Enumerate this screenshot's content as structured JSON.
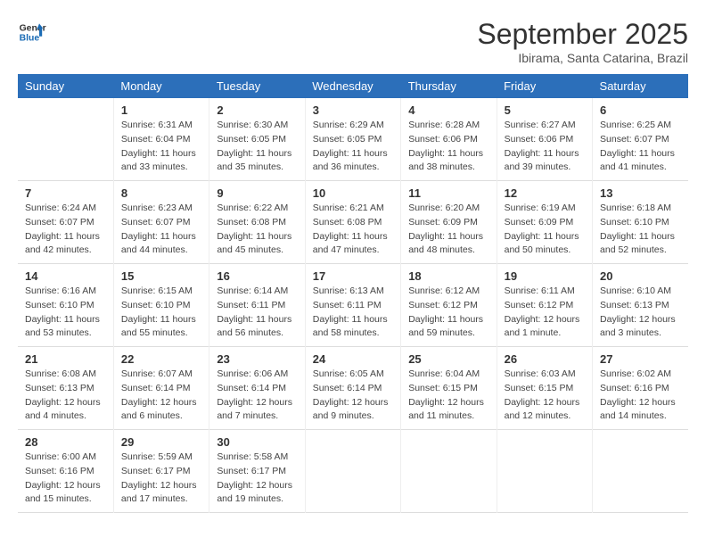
{
  "logo": {
    "line1": "General",
    "line2": "Blue"
  },
  "title": "September 2025",
  "location": "Ibirama, Santa Catarina, Brazil",
  "days_header": [
    "Sunday",
    "Monday",
    "Tuesday",
    "Wednesday",
    "Thursday",
    "Friday",
    "Saturday"
  ],
  "weeks": [
    [
      {
        "num": "",
        "info": ""
      },
      {
        "num": "1",
        "info": "Sunrise: 6:31 AM\nSunset: 6:04 PM\nDaylight: 11 hours\nand 33 minutes."
      },
      {
        "num": "2",
        "info": "Sunrise: 6:30 AM\nSunset: 6:05 PM\nDaylight: 11 hours\nand 35 minutes."
      },
      {
        "num": "3",
        "info": "Sunrise: 6:29 AM\nSunset: 6:05 PM\nDaylight: 11 hours\nand 36 minutes."
      },
      {
        "num": "4",
        "info": "Sunrise: 6:28 AM\nSunset: 6:06 PM\nDaylight: 11 hours\nand 38 minutes."
      },
      {
        "num": "5",
        "info": "Sunrise: 6:27 AM\nSunset: 6:06 PM\nDaylight: 11 hours\nand 39 minutes."
      },
      {
        "num": "6",
        "info": "Sunrise: 6:25 AM\nSunset: 6:07 PM\nDaylight: 11 hours\nand 41 minutes."
      }
    ],
    [
      {
        "num": "7",
        "info": "Sunrise: 6:24 AM\nSunset: 6:07 PM\nDaylight: 11 hours\nand 42 minutes."
      },
      {
        "num": "8",
        "info": "Sunrise: 6:23 AM\nSunset: 6:07 PM\nDaylight: 11 hours\nand 44 minutes."
      },
      {
        "num": "9",
        "info": "Sunrise: 6:22 AM\nSunset: 6:08 PM\nDaylight: 11 hours\nand 45 minutes."
      },
      {
        "num": "10",
        "info": "Sunrise: 6:21 AM\nSunset: 6:08 PM\nDaylight: 11 hours\nand 47 minutes."
      },
      {
        "num": "11",
        "info": "Sunrise: 6:20 AM\nSunset: 6:09 PM\nDaylight: 11 hours\nand 48 minutes."
      },
      {
        "num": "12",
        "info": "Sunrise: 6:19 AM\nSunset: 6:09 PM\nDaylight: 11 hours\nand 50 minutes."
      },
      {
        "num": "13",
        "info": "Sunrise: 6:18 AM\nSunset: 6:10 PM\nDaylight: 11 hours\nand 52 minutes."
      }
    ],
    [
      {
        "num": "14",
        "info": "Sunrise: 6:16 AM\nSunset: 6:10 PM\nDaylight: 11 hours\nand 53 minutes."
      },
      {
        "num": "15",
        "info": "Sunrise: 6:15 AM\nSunset: 6:10 PM\nDaylight: 11 hours\nand 55 minutes."
      },
      {
        "num": "16",
        "info": "Sunrise: 6:14 AM\nSunset: 6:11 PM\nDaylight: 11 hours\nand 56 minutes."
      },
      {
        "num": "17",
        "info": "Sunrise: 6:13 AM\nSunset: 6:11 PM\nDaylight: 11 hours\nand 58 minutes."
      },
      {
        "num": "18",
        "info": "Sunrise: 6:12 AM\nSunset: 6:12 PM\nDaylight: 11 hours\nand 59 minutes."
      },
      {
        "num": "19",
        "info": "Sunrise: 6:11 AM\nSunset: 6:12 PM\nDaylight: 12 hours\nand 1 minute."
      },
      {
        "num": "20",
        "info": "Sunrise: 6:10 AM\nSunset: 6:13 PM\nDaylight: 12 hours\nand 3 minutes."
      }
    ],
    [
      {
        "num": "21",
        "info": "Sunrise: 6:08 AM\nSunset: 6:13 PM\nDaylight: 12 hours\nand 4 minutes."
      },
      {
        "num": "22",
        "info": "Sunrise: 6:07 AM\nSunset: 6:14 PM\nDaylight: 12 hours\nand 6 minutes."
      },
      {
        "num": "23",
        "info": "Sunrise: 6:06 AM\nSunset: 6:14 PM\nDaylight: 12 hours\nand 7 minutes."
      },
      {
        "num": "24",
        "info": "Sunrise: 6:05 AM\nSunset: 6:14 PM\nDaylight: 12 hours\nand 9 minutes."
      },
      {
        "num": "25",
        "info": "Sunrise: 6:04 AM\nSunset: 6:15 PM\nDaylight: 12 hours\nand 11 minutes."
      },
      {
        "num": "26",
        "info": "Sunrise: 6:03 AM\nSunset: 6:15 PM\nDaylight: 12 hours\nand 12 minutes."
      },
      {
        "num": "27",
        "info": "Sunrise: 6:02 AM\nSunset: 6:16 PM\nDaylight: 12 hours\nand 14 minutes."
      }
    ],
    [
      {
        "num": "28",
        "info": "Sunrise: 6:00 AM\nSunset: 6:16 PM\nDaylight: 12 hours\nand 15 minutes."
      },
      {
        "num": "29",
        "info": "Sunrise: 5:59 AM\nSunset: 6:17 PM\nDaylight: 12 hours\nand 17 minutes."
      },
      {
        "num": "30",
        "info": "Sunrise: 5:58 AM\nSunset: 6:17 PM\nDaylight: 12 hours\nand 19 minutes."
      },
      {
        "num": "",
        "info": ""
      },
      {
        "num": "",
        "info": ""
      },
      {
        "num": "",
        "info": ""
      },
      {
        "num": "",
        "info": ""
      }
    ]
  ]
}
